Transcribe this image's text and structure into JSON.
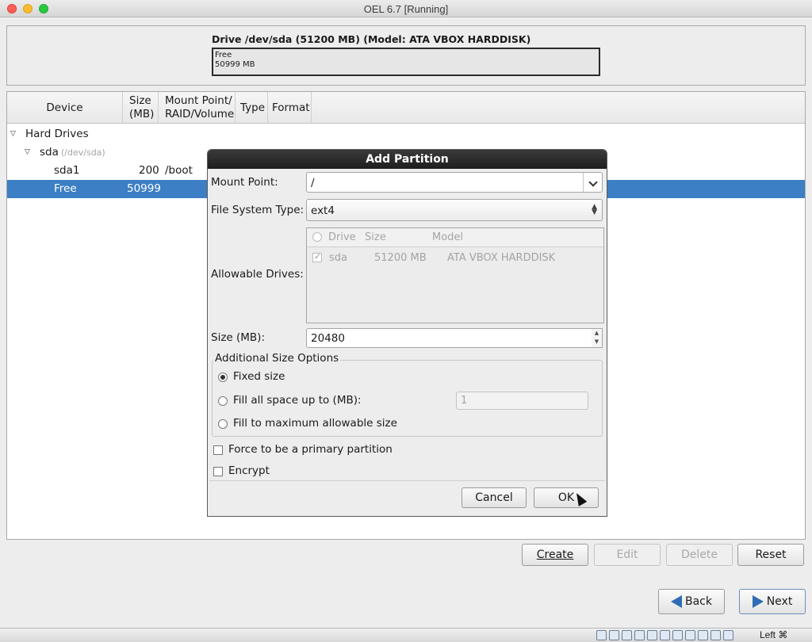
{
  "window": {
    "title": "OEL 6.7 [Running]"
  },
  "drive": {
    "title": "Drive /dev/sda (51200 MB) (Model: ATA VBOX HARDDISK)",
    "segment_label": "Free",
    "segment_size": "50999 MB"
  },
  "tree": {
    "headers": {
      "device": "Device",
      "size": "Size\n(MB)",
      "mount": "Mount Point/\nRAID/Volume",
      "type": "Type",
      "format": "Format"
    },
    "hard_drives": "Hard Drives",
    "sda": {
      "name": "sda",
      "path": "(/dev/sda)"
    },
    "sda1": {
      "name": "sda1",
      "size": "200",
      "mount": "/boot"
    },
    "free": {
      "name": "Free",
      "size": "50999"
    }
  },
  "buttons": {
    "create": "Create",
    "edit": "Edit",
    "delete": "Delete",
    "reset": "Reset",
    "back": "Back",
    "next": "Next"
  },
  "dialog": {
    "title": "Add Partition",
    "mount_point_label": "Mount Point:",
    "mount_point_value": "/",
    "fs_type_label": "File System Type:",
    "fs_type_value": "ext4",
    "allowable_drives_label": "Allowable Drives:",
    "drives_columns": {
      "drive": "Drive",
      "size": "Size",
      "model": "Model"
    },
    "drives_rows": [
      {
        "drive": "sda",
        "size": "51200 MB",
        "model": "ATA VBOX HARDDISK"
      }
    ],
    "size_label": "Size (MB):",
    "size_value": "20480",
    "size_options_title": "Additional Size Options",
    "opt_fixed": "Fixed size",
    "opt_fill_upto": "Fill all space up to (MB):",
    "fill_upto_value": "1",
    "opt_fill_max": "Fill to maximum allowable size",
    "force_primary": "Force to be a primary partition",
    "encrypt": "Encrypt",
    "cancel": "Cancel",
    "ok": "OK"
  },
  "statusbar": {
    "host_key": "Left ⌘"
  }
}
